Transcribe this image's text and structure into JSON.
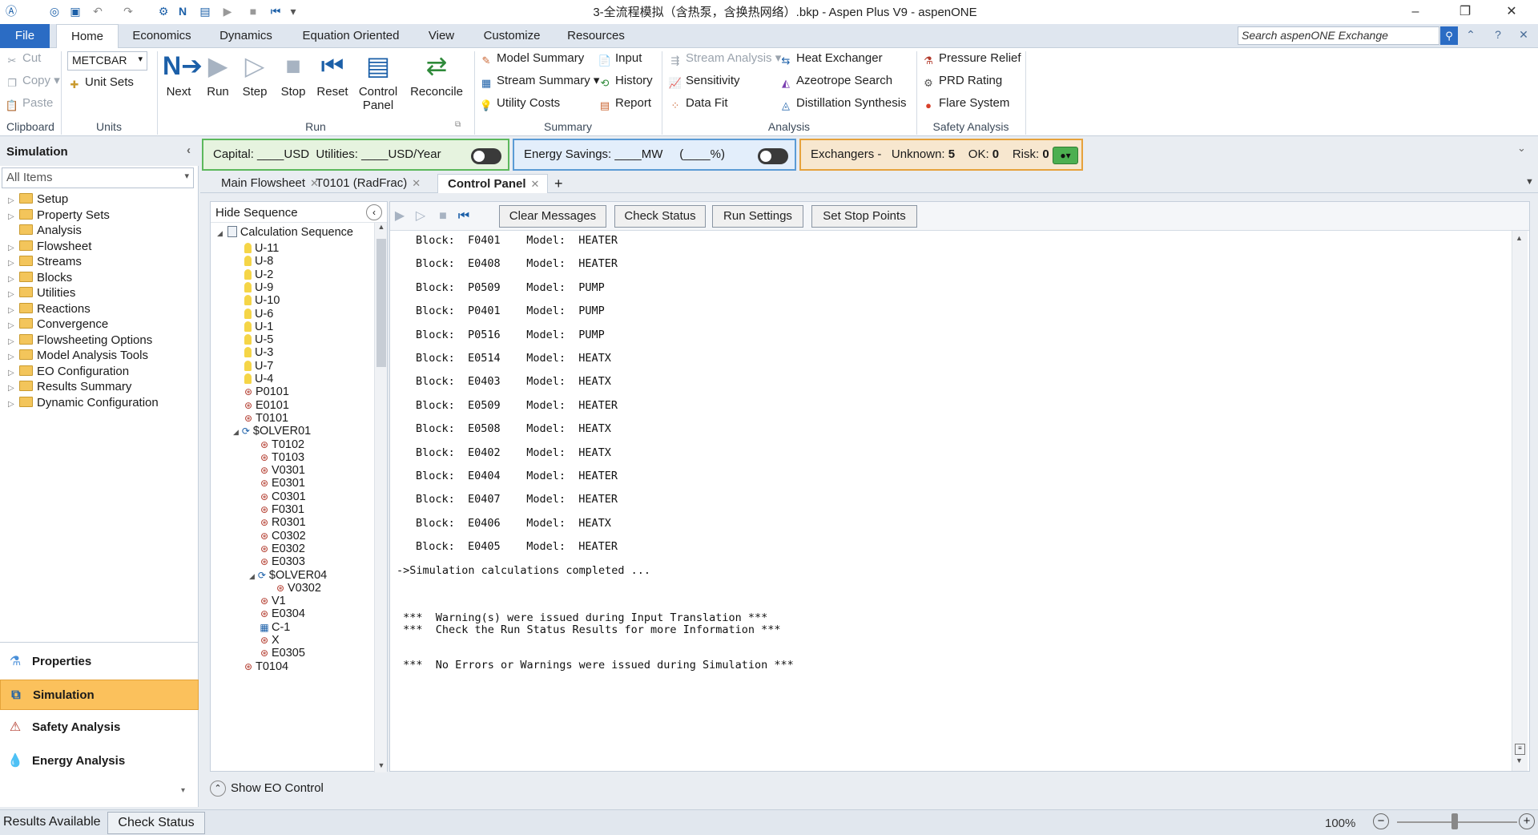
{
  "titlebar": {
    "title": "3-全流程模拟（含热泵，含换热网络）.bkp - Aspen Plus V9 - aspenONE",
    "minimize": "–",
    "restore": "❐",
    "close": "✕"
  },
  "menu": {
    "tabs": [
      "File",
      "Home",
      "Economics",
      "Dynamics",
      "Equation Oriented",
      "View",
      "Customize",
      "Resources"
    ],
    "search_placeholder": "Search aspenONE Exchange"
  },
  "ribbon": {
    "clipboard": {
      "cut": "Cut",
      "copy": "Copy",
      "paste": "Paste",
      "label": "Clipboard"
    },
    "units": {
      "selected": "METCBAR",
      "unit_sets": "Unit Sets",
      "label": "Units"
    },
    "run": {
      "next": "Next",
      "run": "Run",
      "step": "Step",
      "stop": "Stop",
      "reset": "Reset",
      "control_panel_1": "Control",
      "control_panel_2": "Panel",
      "reconcile": "Reconcile",
      "label": "Run"
    },
    "summary": {
      "model_summary": "Model Summary",
      "stream_summary": "Stream Summary",
      "utility_costs": "Utility Costs",
      "input": "Input",
      "history": "History",
      "report": "Report",
      "label": "Summary"
    },
    "analysis": {
      "stream_analysis": "Stream Analysis",
      "sensitivity": "Sensitivity",
      "data_fit": "Data Fit",
      "heat_exchanger": "Heat Exchanger",
      "azeotrope_search": "Azeotrope Search",
      "distillation_synthesis": "Distillation Synthesis",
      "label": "Analysis"
    },
    "safety": {
      "pressure_relief": "Pressure Relief",
      "prd_rating": "PRD Rating",
      "flare_system": "Flare System",
      "label": "Safety Analysis"
    }
  },
  "sidebar": {
    "title": "Simulation",
    "filter": "All Items",
    "items": [
      "Setup",
      "Property Sets",
      "Analysis",
      "Flowsheet",
      "Streams",
      "Blocks",
      "Utilities",
      "Reactions",
      "Convergence",
      "Flowsheeting Options",
      "Model Analysis Tools",
      "EO Configuration",
      "Results Summary",
      "Dynamic Configuration"
    ],
    "bottom": [
      "Properties",
      "Simulation",
      "Safety Analysis",
      "Energy Analysis"
    ]
  },
  "strip": {
    "capital": "Capital: ____USD",
    "utilities": "Utilities: ____USD/Year",
    "energy": "Energy Savings: ____MW     (____%)",
    "exchangers": "Exchangers -",
    "unknown_label": "Unknown:",
    "unknown_val": "5",
    "ok_label": "OK:",
    "ok_val": "0",
    "risk_label": "Risk:",
    "risk_val": "0"
  },
  "doctabs": [
    "Main Flowsheet",
    "T0101 (RadFrac)",
    "Control Panel"
  ],
  "sequence": {
    "hide_label": "Hide Sequence",
    "root": "Calculation Sequence",
    "items": [
      "U-11",
      "U-8",
      "U-2",
      "U-9",
      "U-10",
      "U-6",
      "U-1",
      "U-5",
      "U-3",
      "U-7",
      "U-4",
      "P0101",
      "E0101",
      "T0101",
      "$OLVER01",
      "T0102",
      "T0103",
      "V0301",
      "E0301",
      "C0301",
      "F0301",
      "R0301",
      "C0302",
      "E0302",
      "E0303",
      "$OLVER04",
      "V0302",
      "V1",
      "E0304",
      "C-1",
      "X",
      "E0305",
      "T0104"
    ]
  },
  "control": {
    "buttons": [
      "Clear Messages",
      "Check Status",
      "Run Settings",
      "Set Stop Points"
    ]
  },
  "log": {
    "blocks": [
      [
        "F0401",
        "HEATER"
      ],
      [
        "E0408",
        "HEATER"
      ],
      [
        "P0509",
        "PUMP"
      ],
      [
        "P0401",
        "PUMP"
      ],
      [
        "P0516",
        "PUMP"
      ],
      [
        "E0514",
        "HEATX"
      ],
      [
        "E0403",
        "HEATX"
      ],
      [
        "E0509",
        "HEATER"
      ],
      [
        "E0508",
        "HEATX"
      ],
      [
        "E0402",
        "HEATX"
      ],
      [
        "E0404",
        "HEATER"
      ],
      [
        "E0407",
        "HEATER"
      ],
      [
        "E0406",
        "HEATX"
      ],
      [
        "E0405",
        "HEATER"
      ]
    ],
    "block_label": "Block:",
    "model_label": "Model:",
    "completed": "->Simulation calculations completed ...",
    "warn1": " ***  Warning(s) were issued during Input Translation ***",
    "warn2": " ***  Check the Run Status Results for more Information ***",
    "noerr": " ***  No Errors or Warnings were issued during Simulation ***"
  },
  "eo": {
    "show": "Show EO Control"
  },
  "statusbar": {
    "results": "Results Available",
    "check": "Check Status",
    "zoom": "100%"
  }
}
